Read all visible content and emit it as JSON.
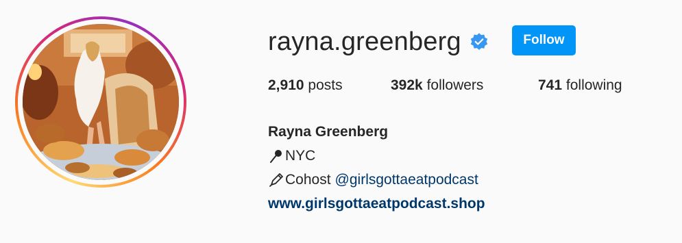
{
  "profile": {
    "username": "rayna.greenberg",
    "verified": true,
    "follow_label": "Follow",
    "accent_color": "#0095f6",
    "verified_color": "#3897f0",
    "link_color": "#00376b"
  },
  "stats": {
    "posts_count": "2,910",
    "posts_label": "posts",
    "followers_count": "392k",
    "followers_label": "followers",
    "following_count": "741",
    "following_label": "following"
  },
  "bio": {
    "name": "Rayna Greenberg",
    "location_icon": "pushpin-icon",
    "location": "NYC",
    "role_icon": "pencil-icon",
    "role_text": "Cohost",
    "mention": "@girlsgottaeatpodcast",
    "website": "www.girlsgottaeatpodcast.shop"
  }
}
